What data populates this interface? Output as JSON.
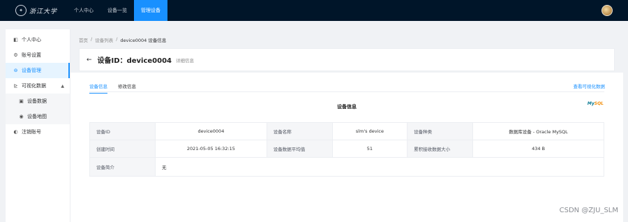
{
  "topbar": {
    "logo_text": "浙江大学",
    "nav": [
      "个人中心",
      "设备一览",
      "管理设备"
    ]
  },
  "sidebar": {
    "items": {
      "profile": "个人中心",
      "account": "账号设置",
      "devices": "设备管理",
      "viz": "可视化数据",
      "device_data": "设备数据",
      "device_map": "设备地图",
      "logout": "注销账号"
    }
  },
  "breadcrumb": [
    "首页",
    "/",
    "设备列表",
    "/",
    "device0004 设备信息"
  ],
  "header": {
    "title": "设备ID：device0004",
    "subtitle": "详细信息"
  },
  "tabs": [
    "设备信息",
    "修改信息"
  ],
  "view_link": "查看可视化数据",
  "section_title": "设备信息",
  "mysql_logo": {
    "a": "My",
    "b": "SQL"
  },
  "table": {
    "row1": [
      "设备ID",
      "device0004",
      "设备名称",
      "slm's device",
      "设备种类",
      "数据库设备 - Oracle MySQL"
    ],
    "row2": [
      "创建时间",
      "2021-05-05 16:32:15",
      "设备数据平均值",
      "51",
      "累积接收数据大小",
      "434 B"
    ],
    "row3": [
      "设备简介",
      "无"
    ]
  },
  "watermark": "CSDN @ZJU_SLM"
}
